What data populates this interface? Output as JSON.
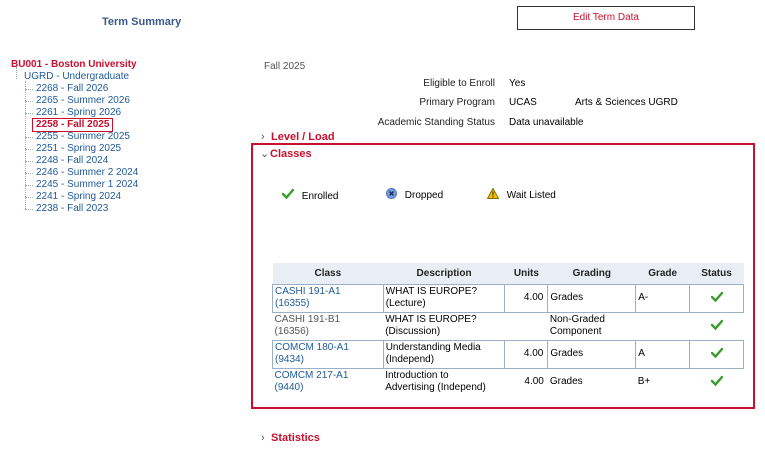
{
  "header": {
    "title": "Term Summary",
    "edit_button": "Edit Term Data"
  },
  "tree": {
    "institution": "BU001 - Boston University",
    "career": "UGRD - Undergraduate",
    "terms": [
      {
        "label": "2268 - Fall 2026",
        "selected": false
      },
      {
        "label": "2265 - Summer 2026",
        "selected": false
      },
      {
        "label": "2261 - Spring 2026",
        "selected": false
      },
      {
        "label": "2258 - Fall 2025",
        "selected": true
      },
      {
        "label": "2255 - Summer 2025",
        "selected": false
      },
      {
        "label": "2251 - Spring 2025",
        "selected": false
      },
      {
        "label": "2248 - Fall 2024",
        "selected": false
      },
      {
        "label": "2246 - Summer 2 2024",
        "selected": false
      },
      {
        "label": "2245 - Summer 1 2024",
        "selected": false
      },
      {
        "label": "2241 - Spring 2024",
        "selected": false
      },
      {
        "label": "2238 - Fall 2023",
        "selected": false
      }
    ]
  },
  "term_info": {
    "term": "Fall 2025",
    "eligible_label": "Eligible to Enroll",
    "eligible_value": "Yes",
    "program_label": "Primary Program",
    "program_value": "UCAS",
    "program_desc": "Arts & Sciences UGRD",
    "standing_label": "Academic Standing Status",
    "standing_value": "Data unavailable"
  },
  "sections": {
    "level_load": "Level / Load",
    "classes": "Classes",
    "statistics": "Statistics"
  },
  "legend": {
    "enrolled": "Enrolled",
    "dropped": "Dropped",
    "wait_listed": "Wait Listed"
  },
  "table": {
    "headers": [
      "Class",
      "Description",
      "Units",
      "Grading",
      "Grade",
      "Status"
    ],
    "rows": [
      {
        "class_line1": "CASHI 191-A1",
        "class_line2": "(16355)",
        "desc_line1": "WHAT IS EUROPE?",
        "desc_line2": "(Lecture)",
        "units": "4.00",
        "grading_line1": "Grades",
        "grading_line2": "",
        "grade": "A-",
        "status": "enrolled"
      },
      {
        "class_line1": "CASHI 191-B1",
        "class_line2": "(16356)",
        "desc_line1": "WHAT IS EUROPE?",
        "desc_line2": "(Discussion)",
        "units": "",
        "grading_line1": "Non-Graded",
        "grading_line2": "Component",
        "grade": "",
        "status": "enrolled"
      },
      {
        "class_line1": "COMCM 180-A1",
        "class_line2": "(9434)",
        "desc_line1": "Understanding Media",
        "desc_line2": "(Independ)",
        "units": "4.00",
        "grading_line1": "Grades",
        "grading_line2": "",
        "grade": "A",
        "status": "enrolled"
      },
      {
        "class_line1": "COMCM 217-A1",
        "class_line2": "(9440)",
        "desc_line1": "Introduction to",
        "desc_line2": "Advertising (Independ)",
        "units": "4.00",
        "grading_line1": "Grades",
        "grading_line2": "",
        "grade": "B+",
        "status": "enrolled"
      }
    ]
  },
  "colors": {
    "accent_red": "#c8102e",
    "link_blue": "#1f5a99",
    "enrolled_green": "#3a9a2a",
    "dropped_blue": "#4a78c8",
    "waitlist_yellow": "#e8b800"
  },
  "icons": {
    "enrolled": "check-icon",
    "dropped": "x-circle-icon",
    "wait_listed": "warning-triangle-icon"
  }
}
